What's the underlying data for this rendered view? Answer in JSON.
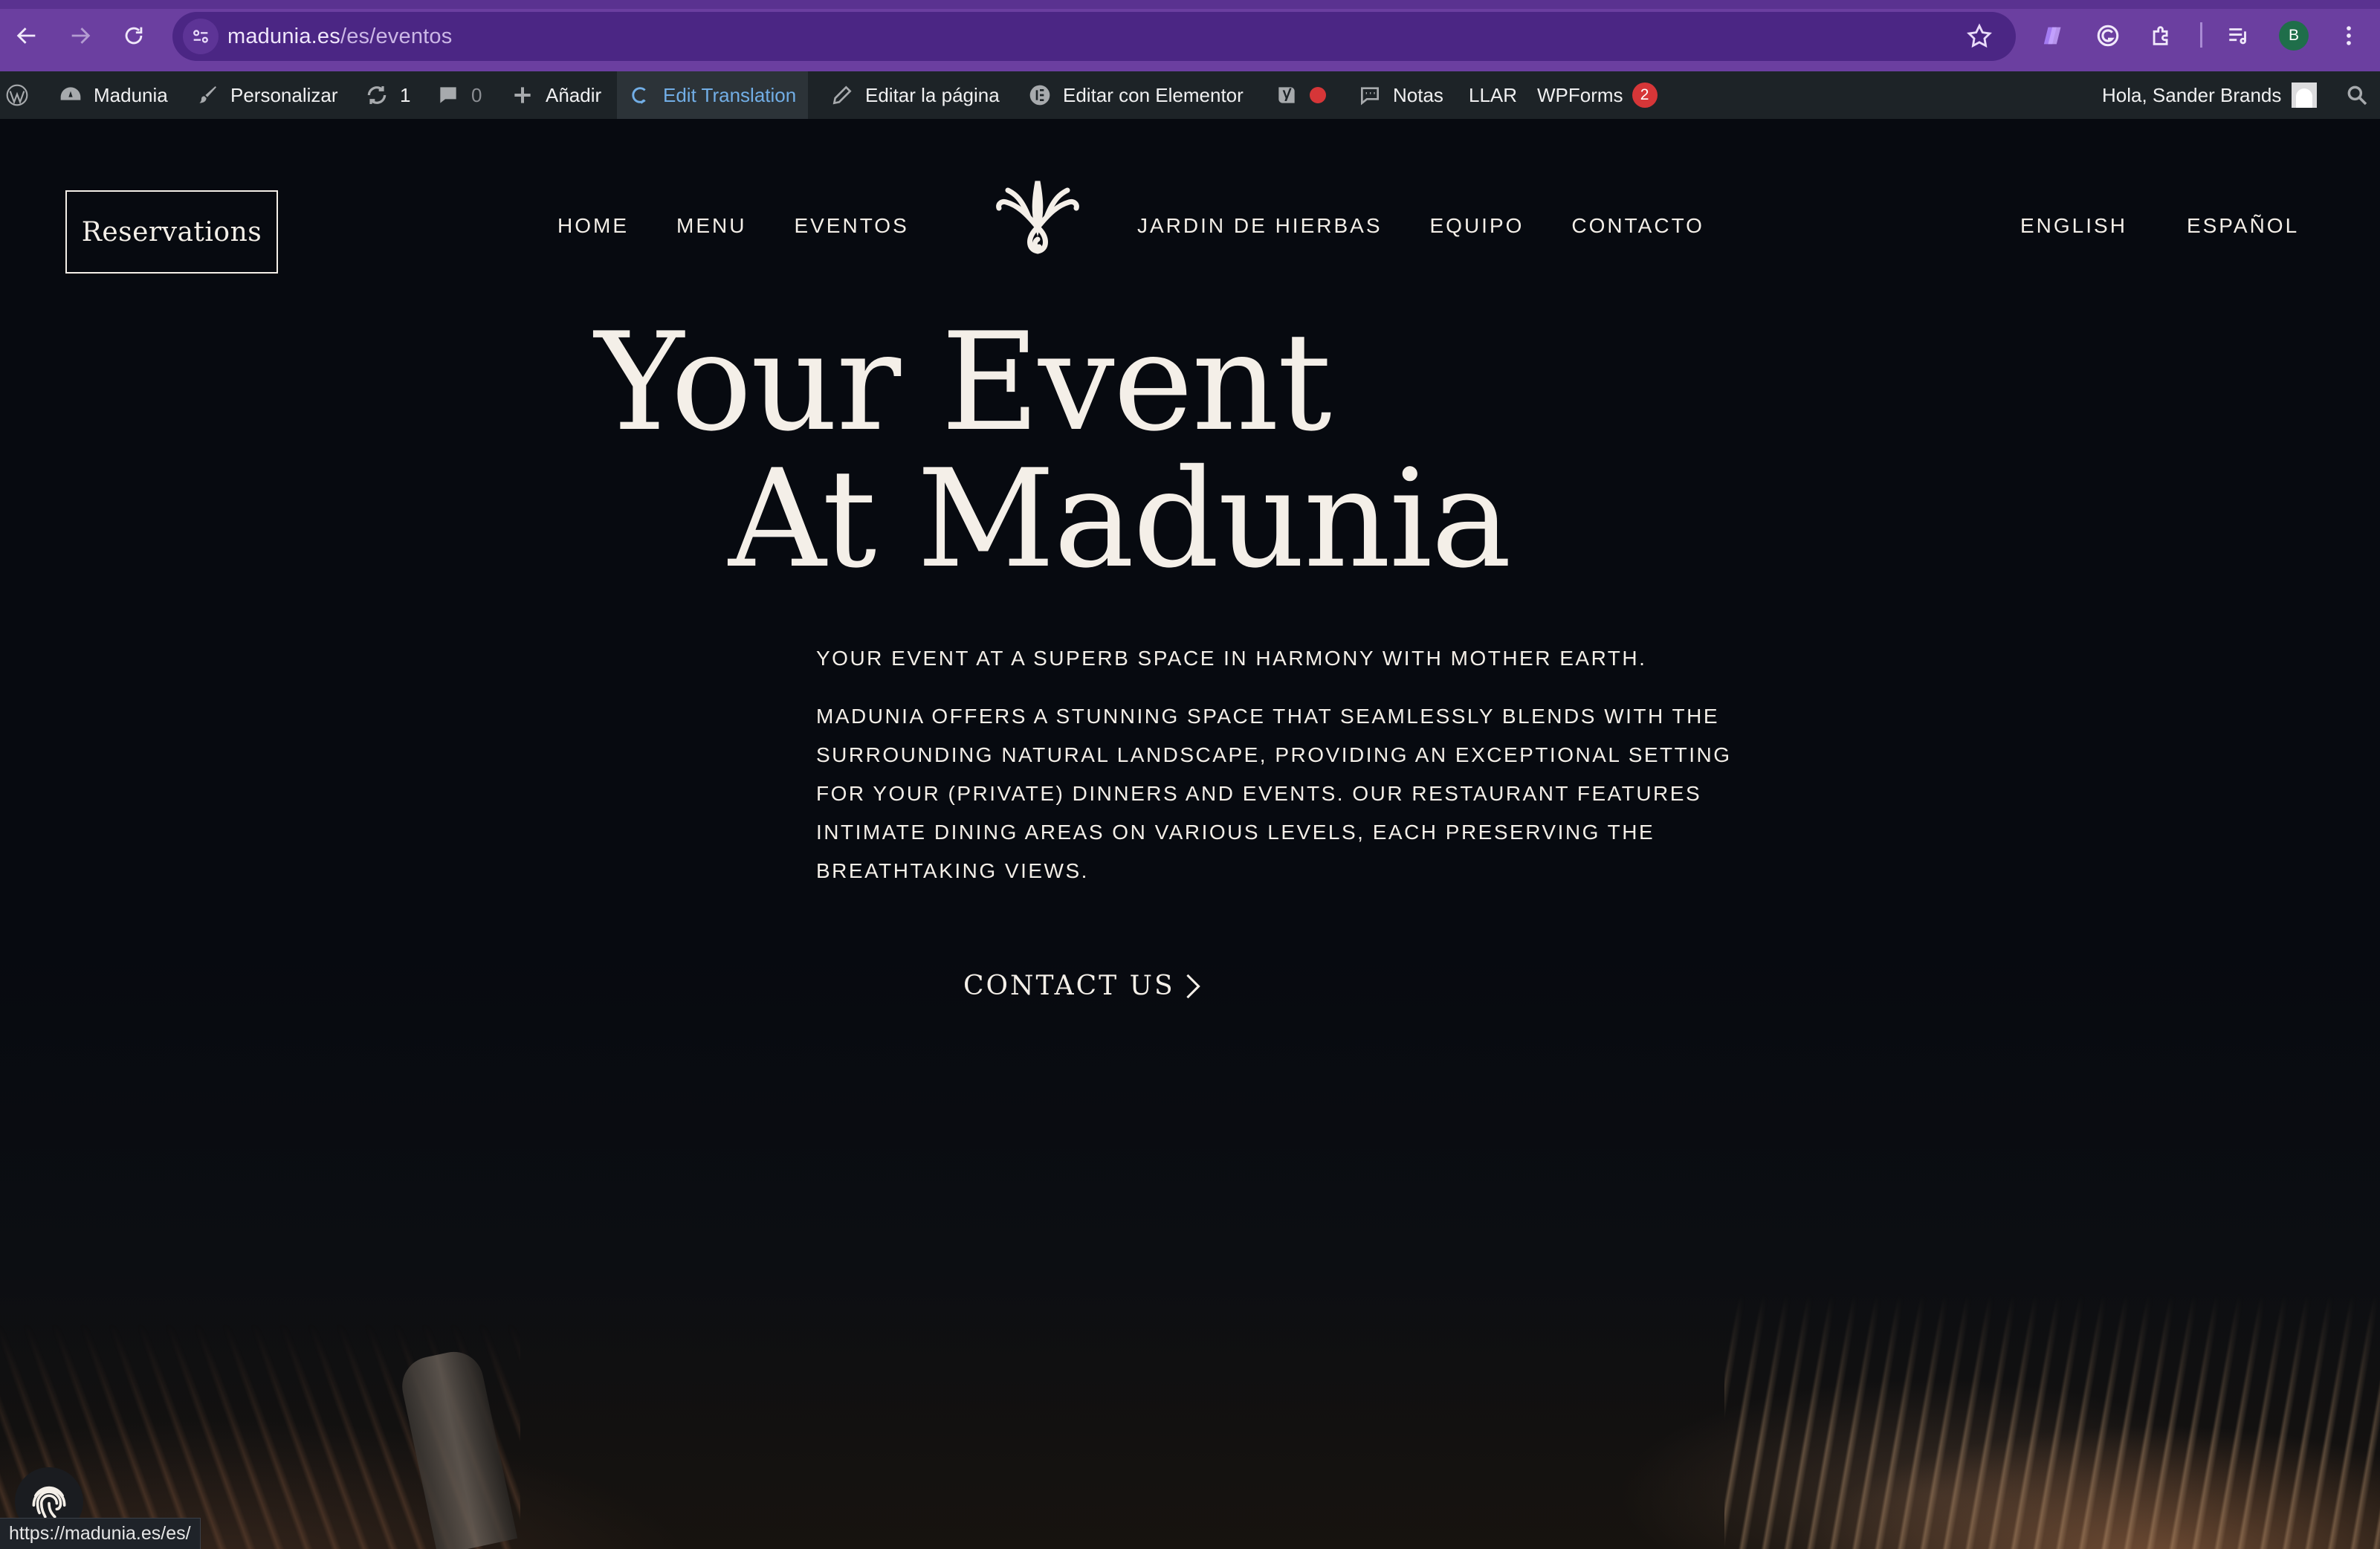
{
  "browser": {
    "url_host": "madunia.es",
    "url_path": "/es/eventos",
    "profile_initial": "B",
    "accent": "#6b3fa0"
  },
  "adminbar": {
    "site_name": "Madunia",
    "customize": "Personalizar",
    "updates_count": "1",
    "comments_count": "0",
    "add_new": "Añadir",
    "edit_translation": "Edit Translation",
    "edit_page": "Editar la página",
    "edit_elementor": "Editar con Elementor",
    "notes": "Notas",
    "llar": "LLAR",
    "wpforms": "WPForms",
    "wpforms_badge": "2",
    "greeting": "Hola, Sander Brands"
  },
  "header": {
    "reservations": "Reservations",
    "nav_left": [
      "HOME",
      "MENU",
      "EVENTOS"
    ],
    "nav_right": [
      "JARDIN DE HIERBAS",
      "EQUIPO",
      "CONTACTO"
    ],
    "languages": [
      "ENGLISH",
      "ESPAÑOL"
    ]
  },
  "hero": {
    "title_line1": "Your Event",
    "title_line2": "At Madunia",
    "lead": "YOUR EVENT AT A SUPERB SPACE IN HARMONY WITH MOTHER EARTH.",
    "body": "MADUNIA OFFERS A STUNNING SPACE THAT SEAMLESSLY BLENDS WITH THE SURROUNDING NATURAL LANDSCAPE, PROVIDING AN EXCEPTIONAL SETTING FOR YOUR (PRIVATE) DINNERS AND EVENTS. OUR RESTAURANT FEATURES INTIMATE DINING AREAS ON VARIOUS LEVELS, EACH PRESERVING THE BREATHTAKING VIEWS.",
    "cta": "CONTACT US"
  },
  "status": {
    "hover_url": "https://madunia.es/es/"
  },
  "icons": [
    "back-icon",
    "forward-icon",
    "reload-icon",
    "site-info-icon",
    "star-icon",
    "extension-icon",
    "grammarly-icon",
    "puzzle-icon",
    "media-icon",
    "menu-icon",
    "wordpress-icon",
    "dashboard-icon",
    "brush-icon",
    "update-icon",
    "comment-icon",
    "plus-icon",
    "translate-icon",
    "pencil-icon",
    "elementor-icon",
    "yoast-icon",
    "notes-icon",
    "search-icon",
    "lotus-logo-icon",
    "chevron-right-icon",
    "fingerprint-icon"
  ]
}
